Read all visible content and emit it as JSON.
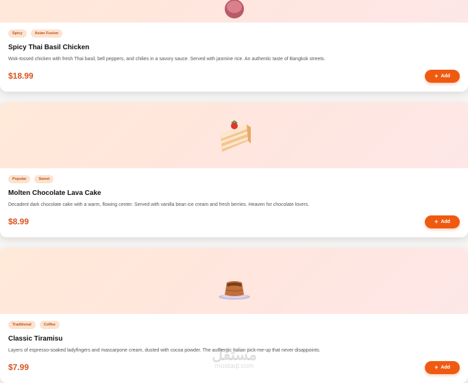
{
  "menu": {
    "items": [
      {
        "tags": [
          "Spicy",
          "Asian Fusion"
        ],
        "name": "Spicy Thai Basil Chicken",
        "description": "Wok-tossed chicken with fresh Thai basil, bell peppers, and chilies in a savory sauce. Served with jasmine rice. An authentic taste of Bangkok streets.",
        "price": "$18.99",
        "add_label": "Add",
        "icon": "curry-bowl-icon"
      },
      {
        "tags": [
          "Popular",
          "Sweet"
        ],
        "name": "Molten Chocolate Lava Cake",
        "description": "Decadent dark chocolate cake with a warm, flowing center. Served with vanilla bean ice cream and fresh berries. Heaven for chocolate lovers.",
        "price": "$8.99",
        "add_label": "Add",
        "icon": "cake-slice-icon"
      },
      {
        "tags": [
          "Traditional",
          "Coffee"
        ],
        "name": "Classic Tiramisu",
        "description": "Layers of espresso-soaked ladyfingers and mascarpone cream, dusted with cocoa powder. The authentic Italian pick-me-up that never disappoints.",
        "price": "$7.99",
        "add_label": "Add",
        "icon": "pudding-icon"
      }
    ]
  },
  "watermark": {
    "arabic": "مستقل",
    "latin": "mostaql.com"
  },
  "colors": {
    "accent": "#ef5a11",
    "price": "#d9541b",
    "tag_bg": "#fde2cf"
  }
}
